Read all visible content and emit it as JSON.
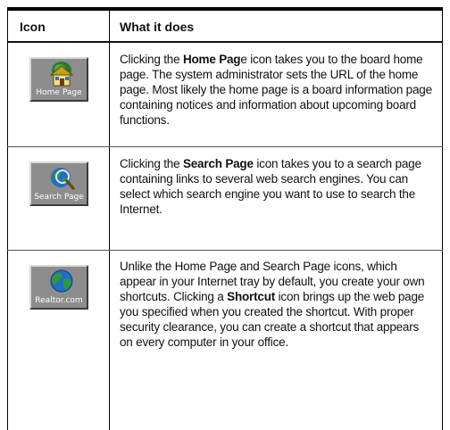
{
  "table": {
    "header": {
      "icon": "Icon",
      "what": "What it does"
    },
    "rows": [
      {
        "icon": {
          "name": "home-page-icon",
          "label": "Home Page"
        },
        "description": {
          "pre": "Clicking the ",
          "bold": "Home Pag",
          "post": "e icon takes you to the board home page. The system administrator sets the URL of the home page. Most likely the home page is a board information page containing notices and information about upcoming board functions."
        }
      },
      {
        "icon": {
          "name": "search-page-icon",
          "label": "Search Page"
        },
        "description": {
          "pre": "Clicking the ",
          "bold": "Search Page",
          "post": " icon takes you to a search page containing links to several web search engines. You can select which search engine you want to use to search the Internet."
        }
      },
      {
        "icon": {
          "name": "realtor-com-icon",
          "label": "Realtor.com"
        },
        "description": {
          "pre": "Unlike the Home Page and Search Page icons, which appear in your Internet tray by default, you create your own shortcuts. Clicking a ",
          "bold": "Shortcut",
          "post": " icon brings up the web page you specified when you created the shortcut. With proper security clearance, you can create a shortcut that appears on every computer in your office."
        }
      }
    ]
  }
}
